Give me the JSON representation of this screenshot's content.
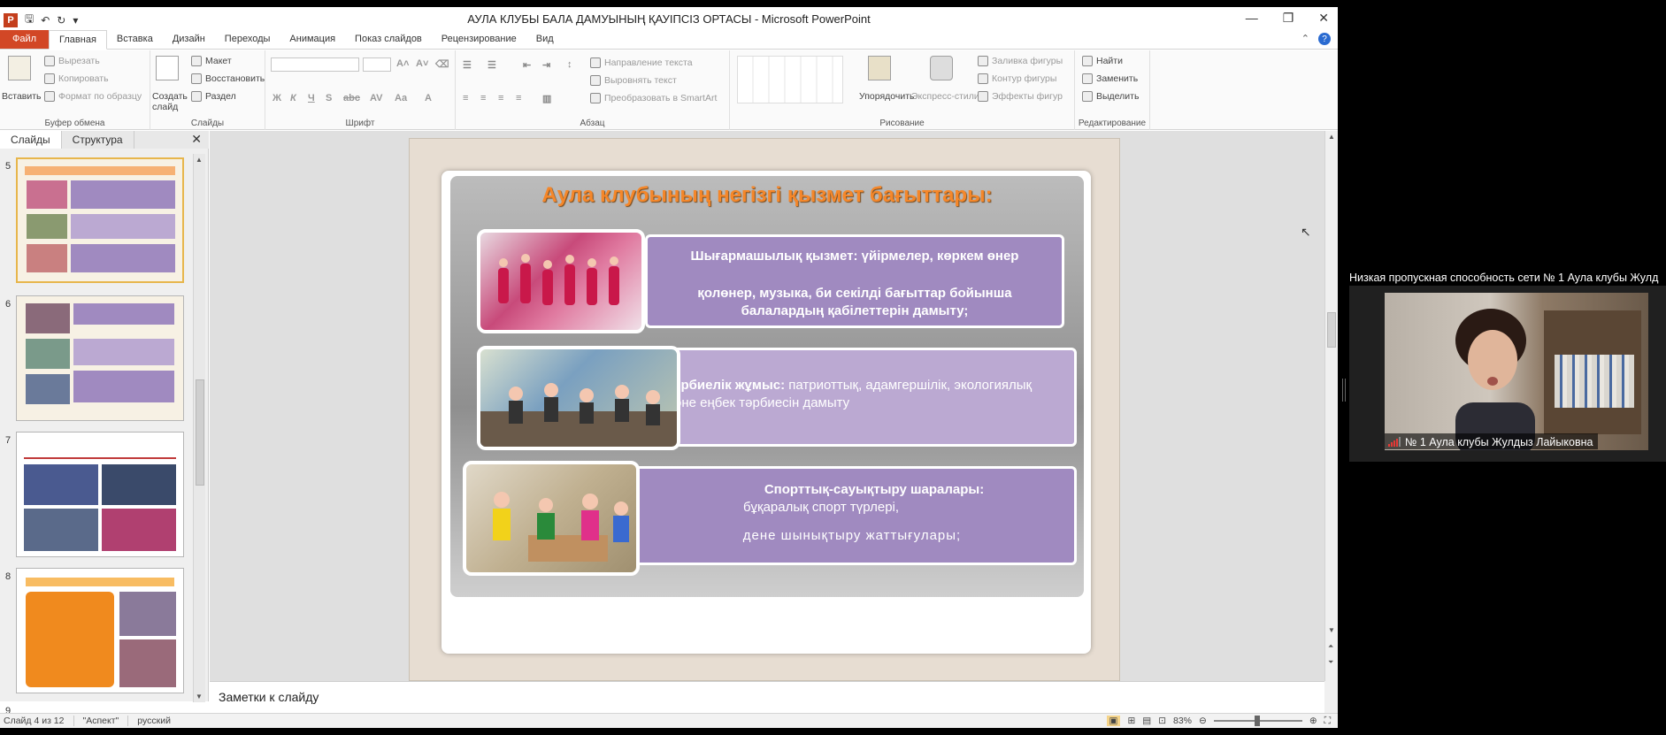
{
  "window": {
    "title": "АУЛА КЛУБЫ БАЛА ДАМУЫНЫҢ ҚАУІПСІЗ ОРТАСЫ  -  Microsoft PowerPoint",
    "app_letter": "P"
  },
  "tabs": [
    "Файл",
    "Главная",
    "Вставка",
    "Дизайн",
    "Переходы",
    "Анимация",
    "Показ слайдов",
    "Рецензирование",
    "Вид"
  ],
  "ribbon": {
    "clipboard": {
      "paste": "Вставить",
      "cut": "Вырезать",
      "copy": "Копировать",
      "format_painter": "Формат по образцу",
      "label": "Буфер обмена"
    },
    "slides": {
      "new_slide": "Создать слайд",
      "layout": "Макет",
      "reset": "Восстановить",
      "section": "Раздел",
      "label": "Слайды"
    },
    "font": {
      "label": "Шрифт"
    },
    "paragraph": {
      "text_direction": "Направление текста",
      "align_text": "Выровнять текст",
      "smartart": "Преобразовать в SmartArt",
      "label": "Абзац"
    },
    "drawing": {
      "arrange": "Упорядочить",
      "quick_styles": "Экспресс-стили",
      "shape_fill": "Заливка фигуры",
      "shape_outline": "Контур фигуры",
      "shape_effects": "Эффекты фигур",
      "label": "Рисование"
    },
    "editing": {
      "find": "Найти",
      "replace": "Заменить",
      "select": "Выделить",
      "label": "Редактирование"
    }
  },
  "pane": {
    "tab_slides": "Слайды",
    "tab_outline": "Структура",
    "close": "✕",
    "thumbs": [
      {
        "num": "5"
      },
      {
        "num": "6"
      },
      {
        "num": "7"
      },
      {
        "num": "8"
      },
      {
        "num": "9"
      }
    ]
  },
  "slide": {
    "title": "Аула клубының негізгі қызмет бағыттары:",
    "items": [
      {
        "bold": "Шығармашылық қызмет: үйірмелер, көркем өнер",
        "text": "қолөнер, музыка, би секілді бағыттар бойынша балалардың қабілеттерін дамыту;"
      },
      {
        "bold": "Тәрбиелік жұмыс:",
        "text": "патриоттық, адамгершілік, экологиялық және еңбек тәрбиесін дамыту"
      },
      {
        "bold": "Спорттық-сауықтыру шаралары:",
        "line2": "бұқаралық спорт түрлері,",
        "line3": "дене шынықтыру жаттығулары;"
      }
    ]
  },
  "notes": {
    "placeholder": "Заметки к слайду"
  },
  "status": {
    "slide_info": "Слайд 4 из 12",
    "theme": "\"Аспект\"",
    "language": "русский",
    "zoom": "83%"
  },
  "video": {
    "warning": "Низкая пропускная способность сети № 1 Аула клубы Жулд",
    "participant": "№ 1 Аула клубы Жулдыз Лайыковна"
  }
}
